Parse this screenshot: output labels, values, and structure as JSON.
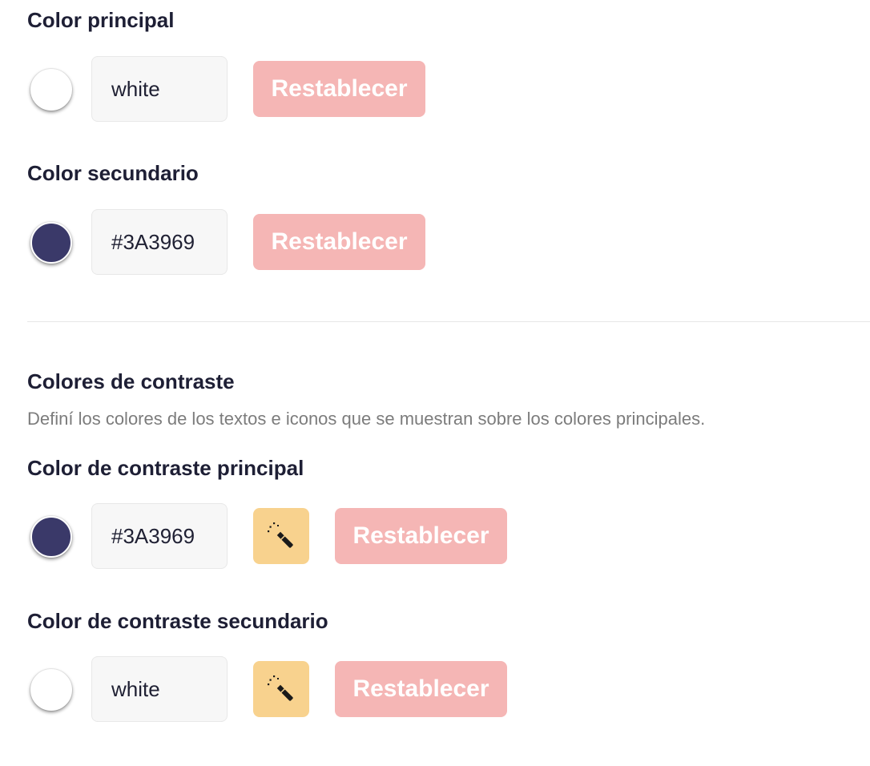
{
  "primary": {
    "label": "Color principal",
    "value": "white",
    "swatch_color": "#ffffff",
    "reset_label": "Restablecer"
  },
  "secondary": {
    "label": "Color secundario",
    "value": "#3A3969",
    "swatch_color": "#3A3969",
    "reset_label": "Restablecer"
  },
  "contrast": {
    "heading": "Colores de contraste",
    "description": "Definí los colores de los textos e iconos que se muestran sobre los colores principales.",
    "primary": {
      "label": "Color de contraste principal",
      "value": "#3A3969",
      "swatch_color": "#3A3969",
      "reset_label": "Restablecer",
      "auto_icon": "magic-wand-icon"
    },
    "secondary": {
      "label": "Color de contraste secundario",
      "value": "white",
      "swatch_color": "#ffffff",
      "reset_label": "Restablecer",
      "auto_icon": "magic-wand-icon"
    }
  },
  "colors": {
    "reset_button_bg": "#f5b6b5",
    "wand_button_bg": "#f8d28e",
    "heading_text": "#1e1f35",
    "description_text": "#7c7c7c"
  }
}
